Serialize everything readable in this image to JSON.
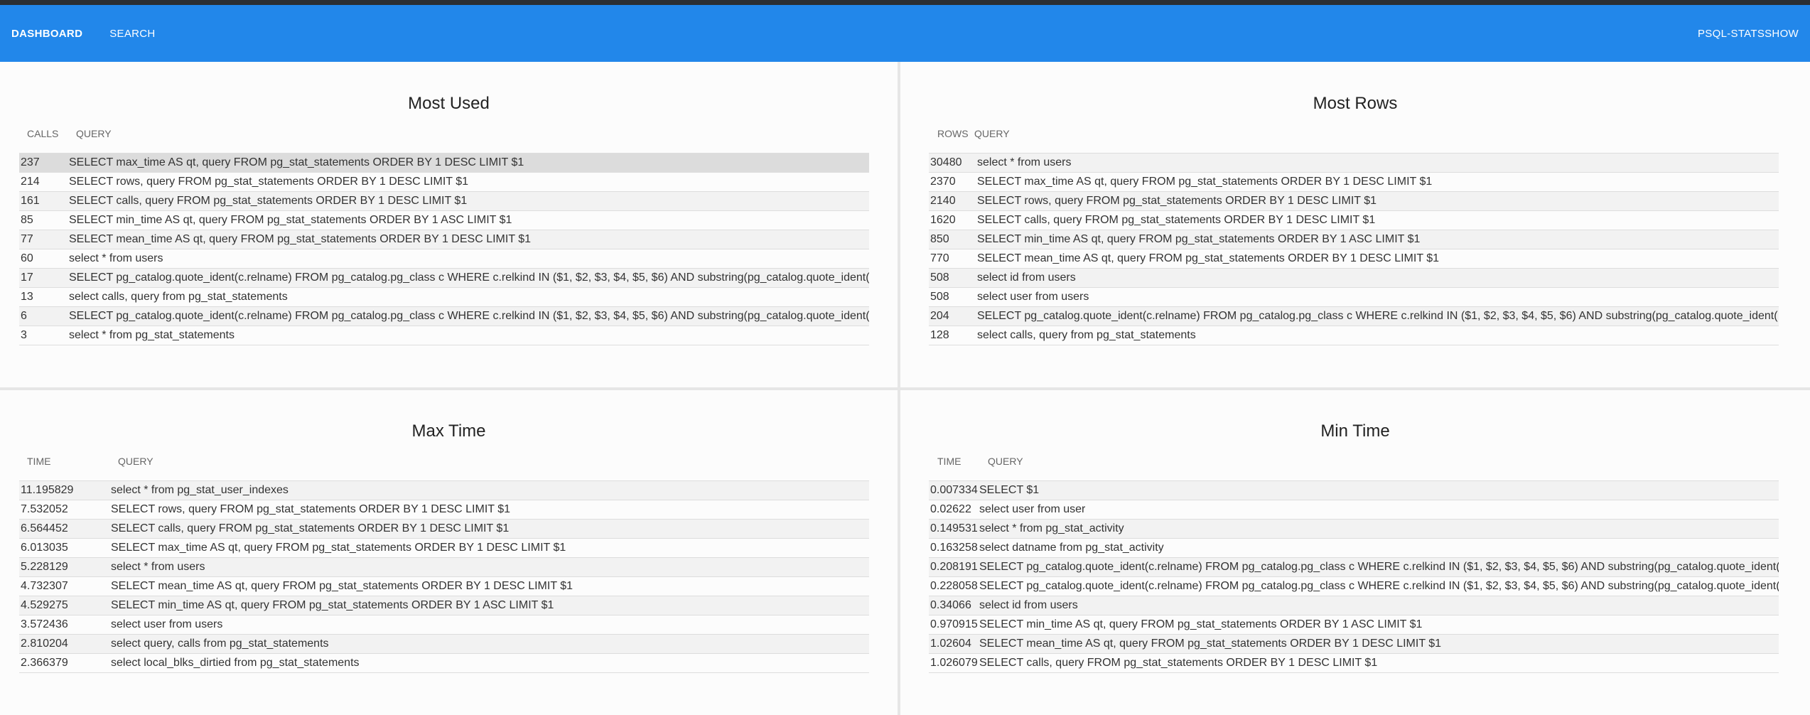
{
  "nav": {
    "items": [
      {
        "label": "DASHBOARD"
      },
      {
        "label": "SEARCH"
      }
    ],
    "brand": "PSQL-STATSSHOW"
  },
  "panels": {
    "most_used": {
      "title": "Most Used",
      "col1": "CALLS",
      "col2": "QUERY",
      "rows": [
        {
          "value": "237",
          "query": "SELECT max_time AS qt, query FROM pg_stat_statements ORDER BY 1 DESC LIMIT $1"
        },
        {
          "value": "214",
          "query": "SELECT rows, query FROM pg_stat_statements ORDER BY 1 DESC LIMIT $1"
        },
        {
          "value": "161",
          "query": "SELECT calls, query FROM pg_stat_statements ORDER BY 1 DESC LIMIT $1"
        },
        {
          "value": "85",
          "query": "SELECT min_time AS qt, query FROM pg_stat_statements ORDER BY 1 ASC LIMIT $1"
        },
        {
          "value": "77",
          "query": "SELECT mean_time AS qt, query FROM pg_stat_statements ORDER BY 1 DESC LIMIT $1"
        },
        {
          "value": "60",
          "query": "select * from users"
        },
        {
          "value": "17",
          "query": "SELECT pg_catalog.quote_ident(c.relname) FROM pg_catalog.pg_class c WHERE c.relkind IN ($1, $2, $3, $4, $5, $6) AND substring(pg_catalog.quote_ident("
        },
        {
          "value": "13",
          "query": "select calls, query from pg_stat_statements"
        },
        {
          "value": "6",
          "query": "SELECT pg_catalog.quote_ident(c.relname) FROM pg_catalog.pg_class c WHERE c.relkind IN ($1, $2, $3, $4, $5, $6) AND substring(pg_catalog.quote_ident("
        },
        {
          "value": "3",
          "query": "select * from pg_stat_statements"
        }
      ]
    },
    "most_rows": {
      "title": "Most Rows",
      "col1": "ROWS",
      "col2": "QUERY",
      "rows": [
        {
          "value": "30480",
          "query": "select * from users"
        },
        {
          "value": "2370",
          "query": "SELECT max_time AS qt, query FROM pg_stat_statements ORDER BY 1 DESC LIMIT $1"
        },
        {
          "value": "2140",
          "query": "SELECT rows, query FROM pg_stat_statements ORDER BY 1 DESC LIMIT $1"
        },
        {
          "value": "1620",
          "query": "SELECT calls, query FROM pg_stat_statements ORDER BY 1 DESC LIMIT $1"
        },
        {
          "value": "850",
          "query": "SELECT min_time AS qt, query FROM pg_stat_statements ORDER BY 1 ASC LIMIT $1"
        },
        {
          "value": "770",
          "query": "SELECT mean_time AS qt, query FROM pg_stat_statements ORDER BY 1 DESC LIMIT $1"
        },
        {
          "value": "508",
          "query": "select id from users"
        },
        {
          "value": "508",
          "query": "select user from users"
        },
        {
          "value": "204",
          "query": "SELECT pg_catalog.quote_ident(c.relname) FROM pg_catalog.pg_class c WHERE c.relkind IN ($1, $2, $3, $4, $5, $6) AND substring(pg_catalog.quote_ident("
        },
        {
          "value": "128",
          "query": "select calls, query from pg_stat_statements"
        }
      ]
    },
    "max_time": {
      "title": "Max Time",
      "col1": "TIME",
      "col2": "QUERY",
      "rows": [
        {
          "value": "11.195829",
          "query": "select * from pg_stat_user_indexes"
        },
        {
          "value": "7.532052",
          "query": "SELECT rows, query FROM pg_stat_statements ORDER BY 1 DESC LIMIT $1"
        },
        {
          "value": "6.564452",
          "query": "SELECT calls, query FROM pg_stat_statements ORDER BY 1 DESC LIMIT $1"
        },
        {
          "value": "6.013035",
          "query": "SELECT max_time AS qt, query FROM pg_stat_statements ORDER BY 1 DESC LIMIT $1"
        },
        {
          "value": "5.228129",
          "query": "select * from users"
        },
        {
          "value": "4.732307",
          "query": "SELECT mean_time AS qt, query FROM pg_stat_statements ORDER BY 1 DESC LIMIT $1"
        },
        {
          "value": "4.529275",
          "query": "SELECT min_time AS qt, query FROM pg_stat_statements ORDER BY 1 ASC LIMIT $1"
        },
        {
          "value": "3.572436",
          "query": "select user from users"
        },
        {
          "value": "2.810204",
          "query": "select query, calls from pg_stat_statements"
        },
        {
          "value": "2.366379",
          "query": "select local_blks_dirtied from pg_stat_statements"
        }
      ]
    },
    "min_time": {
      "title": "Min Time",
      "col1": "TIME",
      "col2": "QUERY",
      "rows": [
        {
          "value": "0.007334",
          "query": "SELECT $1"
        },
        {
          "value": "0.02622",
          "query": "select user from user"
        },
        {
          "value": "0.149531",
          "query": "select * from pg_stat_activity"
        },
        {
          "value": "0.163258",
          "query": "select datname from pg_stat_activity"
        },
        {
          "value": "0.208191",
          "query": "SELECT pg_catalog.quote_ident(c.relname) FROM pg_catalog.pg_class c WHERE c.relkind IN ($1, $2, $3, $4, $5, $6) AND substring(pg_catalog.quote_ident("
        },
        {
          "value": "0.228058",
          "query": "SELECT pg_catalog.quote_ident(c.relname) FROM pg_catalog.pg_class c WHERE c.relkind IN ($1, $2, $3, $4, $5, $6) AND substring(pg_catalog.quote_ident("
        },
        {
          "value": "0.34066",
          "query": "select id from users"
        },
        {
          "value": "0.970915",
          "query": "SELECT min_time AS qt, query FROM pg_stat_statements ORDER BY 1 ASC LIMIT $1"
        },
        {
          "value": "1.02604",
          "query": "SELECT mean_time AS qt, query FROM pg_stat_statements ORDER BY 1 DESC LIMIT $1"
        },
        {
          "value": "1.026079",
          "query": "SELECT calls, query FROM pg_stat_statements ORDER BY 1 DESC LIMIT $1"
        }
      ]
    }
  }
}
